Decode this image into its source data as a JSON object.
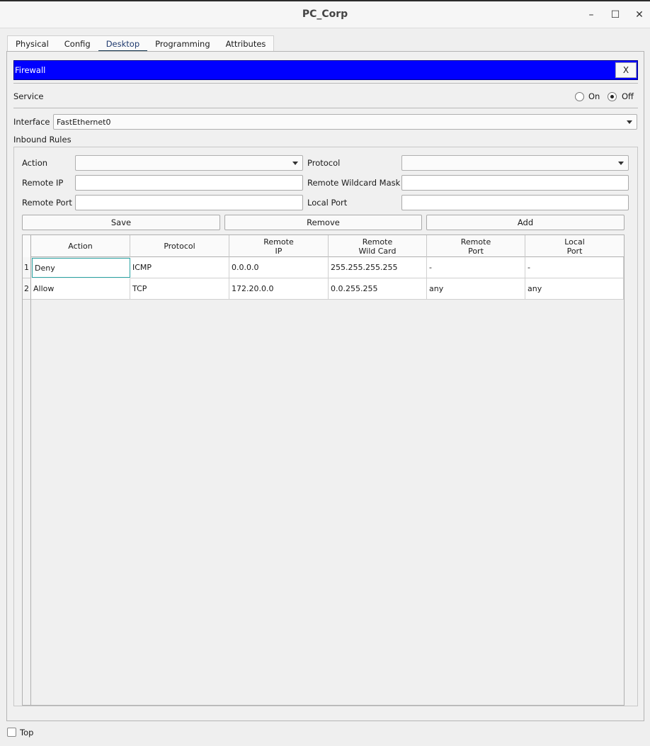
{
  "window": {
    "title": "PC_Corp",
    "minimize": "–",
    "maximize": "☐",
    "close": "✕"
  },
  "tabs": [
    {
      "label": "Physical"
    },
    {
      "label": "Config"
    },
    {
      "label": "Desktop"
    },
    {
      "label": "Programming"
    },
    {
      "label": "Attributes"
    }
  ],
  "active_tab": "Desktop",
  "firewall": {
    "title": "Firewall",
    "close_label": "X",
    "service_label": "Service",
    "service_on_label": "On",
    "service_off_label": "Off",
    "service_value": "Off",
    "interface_label": "Interface",
    "interface_value": "FastEthernet0",
    "inbound_label": "Inbound Rules",
    "form": {
      "action_label": "Action",
      "action_value": "",
      "protocol_label": "Protocol",
      "protocol_value": "",
      "remote_ip_label": "Remote IP",
      "remote_ip_value": "",
      "remote_wildcard_label": "Remote Wildcard Mask",
      "remote_wildcard_value": "",
      "remote_port_label": "Remote Port",
      "remote_port_value": "",
      "local_port_label": "Local Port",
      "local_port_value": ""
    },
    "buttons": {
      "save": "Save",
      "remove": "Remove",
      "add": "Add"
    },
    "table": {
      "headers": [
        "Action",
        "Protocol",
        "Remote\nIP",
        "Remote\nWild Card",
        "Remote\nPort",
        "Local\nPort"
      ],
      "rows": [
        {
          "num": "1",
          "cells": [
            "Deny",
            "ICMP",
            "0.0.0.0",
            "255.255.255.255",
            "-",
            "-"
          ]
        },
        {
          "num": "2",
          "cells": [
            "Allow",
            "TCP",
            "172.20.0.0",
            "0.0.255.255",
            "any",
            "any"
          ]
        }
      ]
    }
  },
  "footer": {
    "top_label": "Top",
    "top_checked": false
  }
}
